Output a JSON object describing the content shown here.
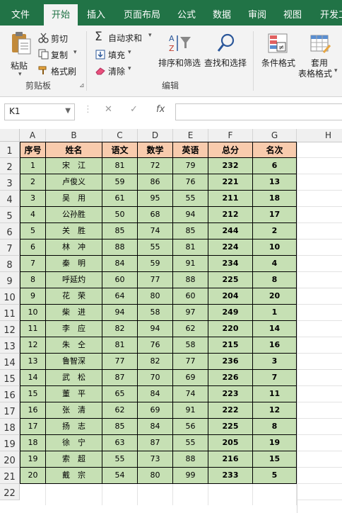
{
  "tabs": [
    "文件",
    "开始",
    "插入",
    "页面布局",
    "公式",
    "数据",
    "审阅",
    "视图",
    "开发工"
  ],
  "active_tab": "开始",
  "ribbon": {
    "paste": "粘贴",
    "cut": "剪切",
    "copy": "复制",
    "format_painter": "格式刷",
    "clipboard_group": "剪贴板",
    "autosum": "自动求和",
    "fill": "填充",
    "clear": "清除",
    "sort_filter": "排序和筛选",
    "find_select": "查找和选择",
    "edit_group": "编辑",
    "cond_format": "条件格式",
    "table_format_1": "套用",
    "table_format_2": "表格格式"
  },
  "formula_bar": {
    "name_box": "K1",
    "cancel": "✕",
    "enter": "✓",
    "fx": "fx",
    "formula": ""
  },
  "columns": [
    "A",
    "B",
    "C",
    "D",
    "E",
    "F",
    "G",
    "H"
  ],
  "rows": [
    "1",
    "2",
    "3",
    "4",
    "5",
    "6",
    "7",
    "8",
    "9",
    "10",
    "11",
    "12",
    "13",
    "14",
    "15",
    "16",
    "17",
    "18",
    "19",
    "20",
    "21",
    "22"
  ],
  "table": {
    "headers": [
      "序号",
      "姓名",
      "语文",
      "数学",
      "英语",
      "总分",
      "名次"
    ],
    "data": [
      [
        "1",
        "宋　江",
        "81",
        "72",
        "79",
        "232",
        "6"
      ],
      [
        "2",
        "卢俊义",
        "59",
        "86",
        "76",
        "221",
        "13"
      ],
      [
        "3",
        "吴　用",
        "61",
        "95",
        "55",
        "211",
        "18"
      ],
      [
        "4",
        "公孙胜",
        "50",
        "68",
        "94",
        "212",
        "17"
      ],
      [
        "5",
        "关　胜",
        "85",
        "74",
        "85",
        "244",
        "2"
      ],
      [
        "6",
        "林　冲",
        "88",
        "55",
        "81",
        "224",
        "10"
      ],
      [
        "7",
        "秦　明",
        "84",
        "59",
        "91",
        "234",
        "4"
      ],
      [
        "8",
        "呼延灼",
        "60",
        "77",
        "88",
        "225",
        "8"
      ],
      [
        "9",
        "花　荣",
        "64",
        "80",
        "60",
        "204",
        "20"
      ],
      [
        "10",
        "柴　进",
        "94",
        "58",
        "97",
        "249",
        "1"
      ],
      [
        "11",
        "李　应",
        "82",
        "94",
        "62",
        "220",
        "14"
      ],
      [
        "12",
        "朱　仝",
        "81",
        "76",
        "58",
        "215",
        "16"
      ],
      [
        "13",
        "鲁智深",
        "77",
        "82",
        "77",
        "236",
        "3"
      ],
      [
        "14",
        "武　松",
        "87",
        "70",
        "69",
        "226",
        "7"
      ],
      [
        "15",
        "董　平",
        "65",
        "84",
        "74",
        "223",
        "11"
      ],
      [
        "16",
        "张　清",
        "62",
        "69",
        "91",
        "222",
        "12"
      ],
      [
        "17",
        "扬　志",
        "85",
        "84",
        "56",
        "225",
        "8"
      ],
      [
        "18",
        "徐　宁",
        "63",
        "87",
        "55",
        "205",
        "19"
      ],
      [
        "19",
        "索　超",
        "55",
        "73",
        "88",
        "216",
        "15"
      ],
      [
        "20",
        "戴　宗",
        "54",
        "80",
        "99",
        "233",
        "5"
      ]
    ]
  },
  "colors": {
    "accent": "#217346",
    "header_fill": "#f8cbad",
    "body_fill": "#c6e0b4"
  }
}
